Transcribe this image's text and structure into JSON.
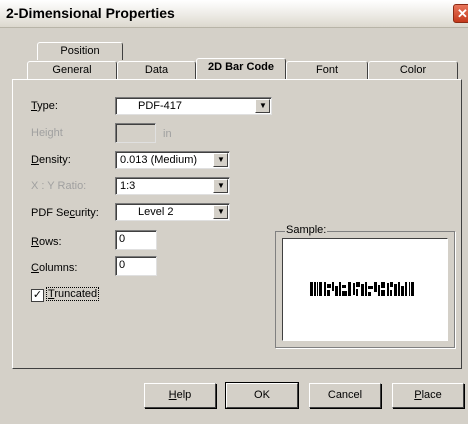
{
  "window": {
    "title": "2-Dimensional Properties",
    "close_glyph": "✕"
  },
  "tabs": {
    "row_back": [
      {
        "label": "Position"
      }
    ],
    "row_front": [
      {
        "label": "General"
      },
      {
        "label": "Data"
      },
      {
        "label": "2D Bar Code",
        "active": true
      },
      {
        "label": "Font"
      },
      {
        "label": "Color"
      }
    ]
  },
  "form": {
    "type": {
      "label_pre": "",
      "label_u": "T",
      "label_post": "ype:",
      "value": "PDF-417"
    },
    "height": {
      "label": "Height",
      "value": "",
      "unit": "in"
    },
    "density": {
      "label_u": "D",
      "label_post": "ensity:",
      "value": "0.013 (Medium)"
    },
    "ratio": {
      "label": "X : Y Ratio:",
      "value": "1:3"
    },
    "security": {
      "label_pre": "PDF Se",
      "label_u": "c",
      "label_post": "urity:",
      "value": "Level 2"
    },
    "rows": {
      "label_u": "R",
      "label_post": "ows:",
      "value": "0"
    },
    "columns": {
      "label_u": "C",
      "label_post": "olumns:",
      "value": "0"
    },
    "truncated": {
      "label_u": "T",
      "label_post": "runcated",
      "checked": true,
      "check_glyph": "✓"
    }
  },
  "sample": {
    "legend": "Sample:"
  },
  "buttons": {
    "help": {
      "label_u": "H",
      "label_post": "elp"
    },
    "ok": {
      "label": "OK"
    },
    "cancel": {
      "label": "Cancel"
    },
    "place": {
      "label_u": "P",
      "label_post": "lace"
    }
  }
}
